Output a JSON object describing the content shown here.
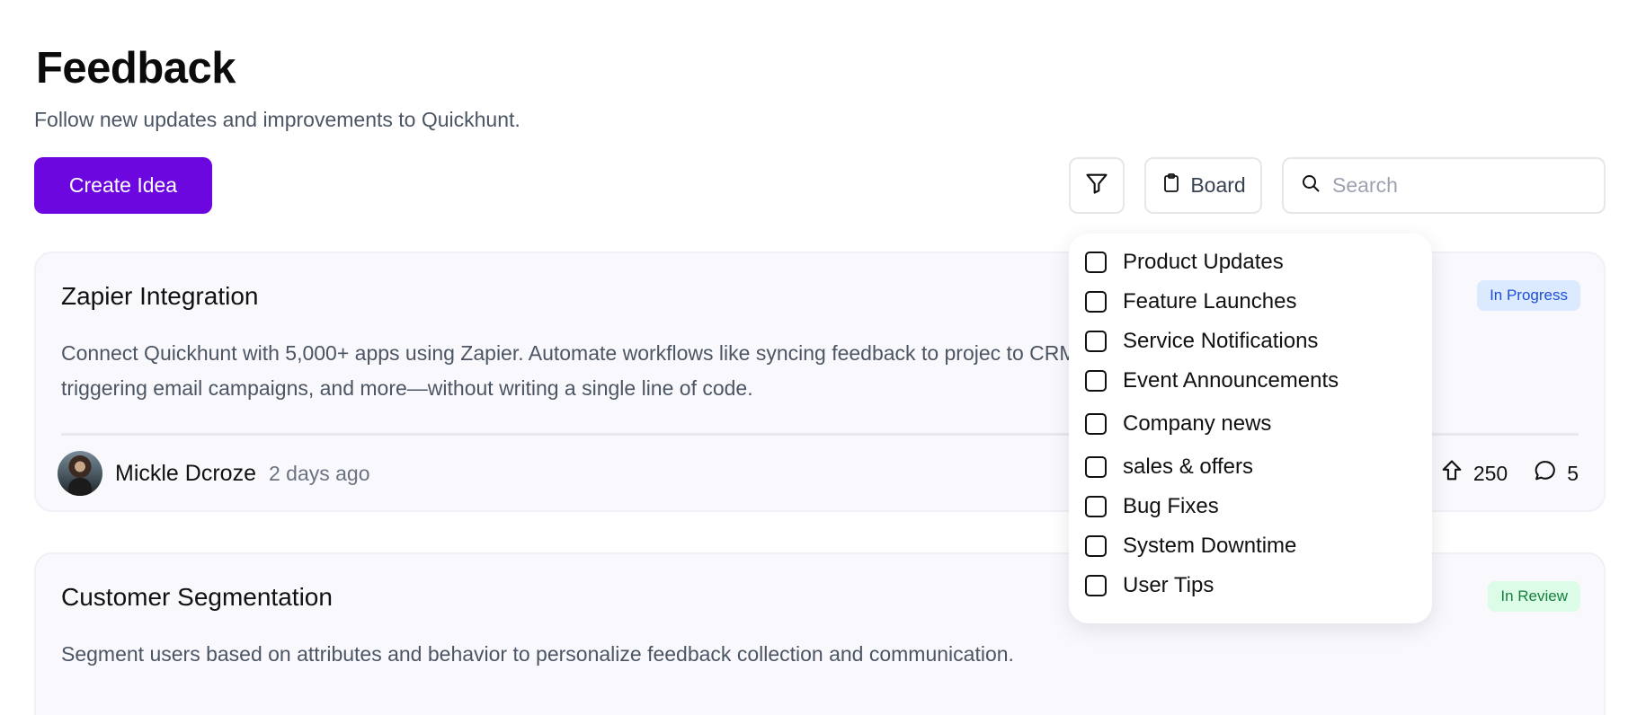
{
  "header": {
    "title": "Feedback",
    "subtitle": "Follow new updates and improvements to Quickhunt."
  },
  "toolbar": {
    "create_label": "Create Idea",
    "board_label": "Board",
    "search_placeholder": "Search",
    "accent_color": "#6d07e0"
  },
  "ideas": [
    {
      "title": "Zapier Integration",
      "description": "Connect Quickhunt with 5,000+ apps using Zapier. Automate workflows like syncing feedback to projec to CRMs, triggering email campaigns, and more—without writing a single line of code.",
      "status": "In Progress",
      "author": "Mickle Dcroze",
      "time": "2 days ago",
      "upvotes": "250",
      "comments": "5"
    },
    {
      "title": "Customer Segmentation",
      "description": "Segment users based on attributes and behavior to personalize feedback collection and communication.",
      "status": "In Review"
    }
  ],
  "filter_menu": {
    "items": [
      "Product Updates",
      "Feature Launches",
      "Service Notifications",
      "Event Announcements",
      "Company news",
      "sales & offers",
      "Bug Fixes",
      "System Downtime",
      "User Tips"
    ]
  }
}
